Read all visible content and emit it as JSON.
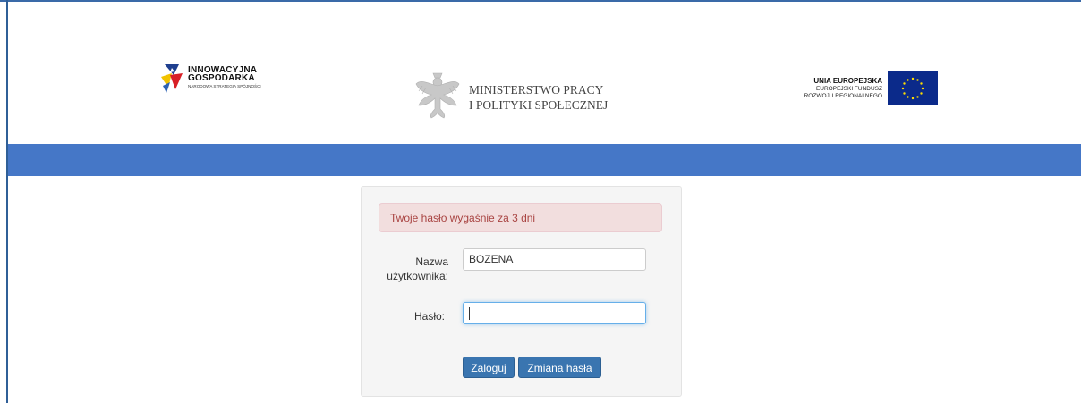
{
  "header": {
    "logo_ig": {
      "line1": "INNOWACYJNA",
      "line2": "GOSPODARKA",
      "line3": "NARODOWA STRATEGIA SPÓJNOŚCI"
    },
    "logo_ministry": {
      "line1": "MINISTERSTWO PRACY",
      "line2": "I POLITYKI SPOŁECZNEJ"
    },
    "logo_eu": {
      "line1": "UNIA EUROPEJSKA",
      "line2": "EUROPEJSKI FUNDUSZ",
      "line3": "ROZWOJU REGIONALNEGO"
    }
  },
  "colors": {
    "header_bar": "#4577c7",
    "button": "#3a75b0",
    "alert_bg": "#f2dede",
    "alert_text": "#a94442"
  },
  "login": {
    "alert": "Twoje hasło wygaśnie za 3 dni",
    "username_label_line1": "Nazwa",
    "username_label_line2": "użytkownika:",
    "username_value": "BOZENA",
    "password_label": "Hasło:",
    "password_value": "",
    "login_button": "Zaloguj",
    "change_password_button": "Zmiana hasła"
  }
}
